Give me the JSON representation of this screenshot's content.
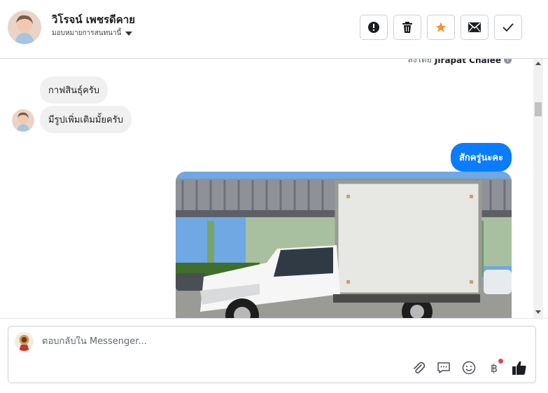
{
  "header": {
    "contact_name": "วิโรจน์ เพชรดีคาย",
    "assign_label": "มอบหมายการสนทนานี้",
    "actions": [
      {
        "name": "report-button",
        "icon": "exclamation-icon"
      },
      {
        "name": "delete-button",
        "icon": "trash-icon"
      },
      {
        "name": "star-button",
        "icon": "star-icon",
        "color": "#f7923a"
      },
      {
        "name": "mark-unread-button",
        "icon": "envelope-icon"
      },
      {
        "name": "mark-done-button",
        "icon": "check-icon"
      }
    ]
  },
  "conversation": {
    "sent_by_prefix": "ส่งโดย",
    "sent_by_name": "Jirapat Chalee",
    "messages": [
      {
        "direction": "in",
        "text": "กาฟสินธุ์ครับ"
      },
      {
        "direction": "in",
        "text": "มีรูปเพิ่มเติมมั้ยครับ"
      },
      {
        "direction": "out",
        "text": "สักครู่นะคะ"
      }
    ],
    "photo": {
      "subject": "white pickup truck with insulated box body"
    }
  },
  "composer": {
    "placeholder": "ตอบกลับใน Messenger...",
    "tools": [
      "attach-icon",
      "saved-reply-icon",
      "emoji-icon",
      "baht-icon",
      "like-icon"
    ],
    "baht_symbol": "฿"
  },
  "colors": {
    "brand_blue": "#0a7cff",
    "incoming_bubble": "#f0f0f0",
    "star": "#f7923a",
    "notification_dot": "#e4405f"
  }
}
